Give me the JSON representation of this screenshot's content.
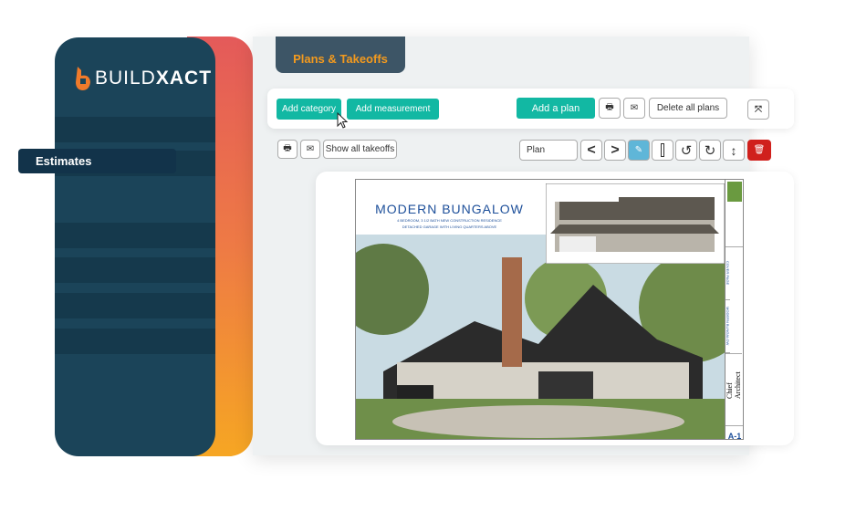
{
  "brand": {
    "logo_light": "BUILD",
    "logo_bold": "XACT"
  },
  "sidebar": {
    "items": [
      {
        "label": "Estimates"
      }
    ]
  },
  "tab": {
    "label": "Plans & Takeoffs"
  },
  "toolbar": {
    "add_category": "Add category",
    "add_measurement": "Add measurement",
    "add_plan": "Add a plan",
    "delete_all": "Delete all plans"
  },
  "subtoolbar": {
    "show_all": "Show all takeoffs",
    "plan_select": "Plan"
  },
  "sheet": {
    "title": "MODERN BUNGALOW",
    "subtitle1": "4 BEDROOM, 3 1/2 BATH NEW CONSTRUCTION RESIDENCE",
    "subtitle2": "DETACHED GARAGE WITH LIVING QUARTERS ABOVE",
    "side_cover": "COVER PAGE",
    "side_name": "MODERN BUNGALOW",
    "side_brand": "Chief Architect",
    "sheet_no": "A-1"
  },
  "colors": {
    "accent": "#12b8a3",
    "sidebar": "#1b4459",
    "tab_text": "#f39a1e",
    "delete": "#d0201c"
  }
}
